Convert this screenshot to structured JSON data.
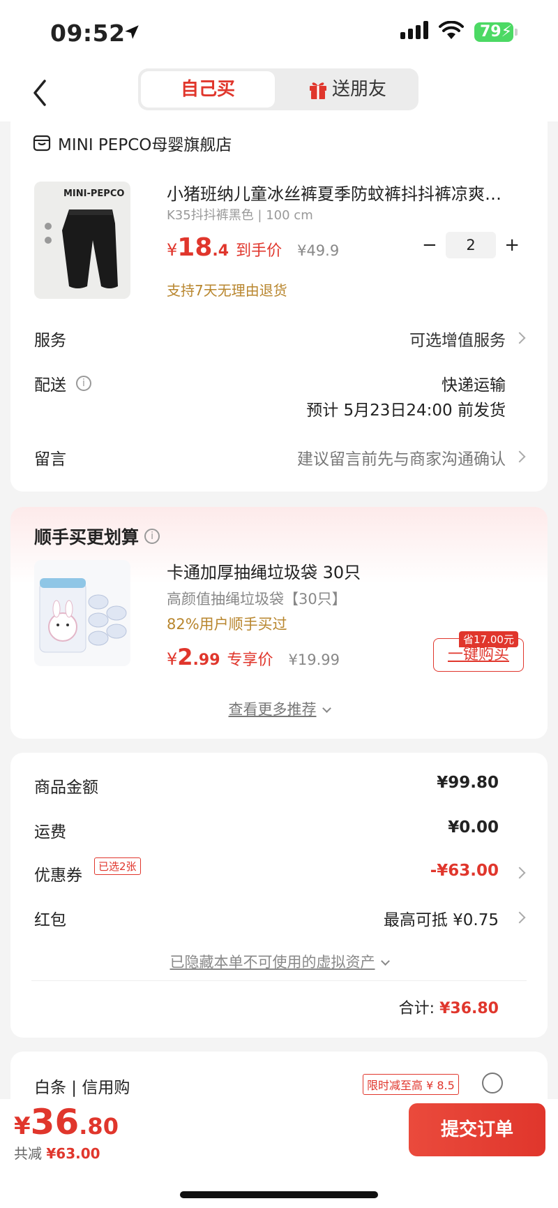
{
  "status_bar": {
    "time": "09:52",
    "battery": "79"
  },
  "nav": {
    "tab_self": "自己买",
    "tab_gift": "送朋友"
  },
  "order": {
    "store_name": "MINI PEPCO母婴旗舰店",
    "product": {
      "image_brand": "MINI-PEPCO",
      "title": "小猪班纳儿童冰丝裤夏季防蚊裤抖抖裤凉爽…",
      "sku": "K35抖抖裤黑色 | 100 cm",
      "price_yen": "¥",
      "price_int": "18",
      "price_dec": ".4",
      "price_tag": "到手价",
      "original_price": "¥49.9",
      "quantity": "2",
      "minus": "−",
      "plus": "+",
      "return_policy": "支持7天无理由退货"
    },
    "service_label": "服务",
    "service_value": "可选增值服务",
    "delivery_label": "配送",
    "delivery_method": "快递运输",
    "delivery_eta": "预计 5月23日24:00 前发货",
    "note_label": "留言",
    "note_placeholder": "建议留言前先与商家沟通确认"
  },
  "recommend": {
    "title": "顺手买更划算",
    "item_name": "卡通加厚抽绳垃圾袋 30只",
    "item_sub": "高颜值抽绳垃圾袋【30只】",
    "item_pct": "82%用户顺手买过",
    "price_yen": "¥",
    "price_int": "2",
    "price_dec": ".99",
    "price_tag": "专享价",
    "original_price": "¥19.99",
    "save_badge": "省17.00元",
    "buy_button": "一键购买",
    "more": "查看更多推荐"
  },
  "summary": {
    "goods_label": "商品金额",
    "goods_value": "¥99.80",
    "shipping_label": "运费",
    "shipping_value": "¥0.00",
    "coupon_label": "优惠券",
    "coupon_badge": "已选2张",
    "coupon_value": "-¥63.00",
    "redpacket_label": "红包",
    "redpacket_value": "最高可抵 ¥0.75",
    "hidden_assets": "已隐藏本单不可使用的虚拟资产",
    "total_label": "合计:",
    "total_value": "¥36.80"
  },
  "payment": {
    "method_label": "白条 | 信用购",
    "promo_badge": "限时减至高 ¥ 8.5"
  },
  "bottom": {
    "yen": "¥",
    "total_int": "36",
    "total_dec": ".80",
    "discount_label": "共减",
    "discount_value": "¥63.00",
    "submit": "提交订单"
  },
  "colors": {
    "accent": "#e0362c",
    "gold": "#b8862e",
    "background": "#f4f4f4"
  }
}
